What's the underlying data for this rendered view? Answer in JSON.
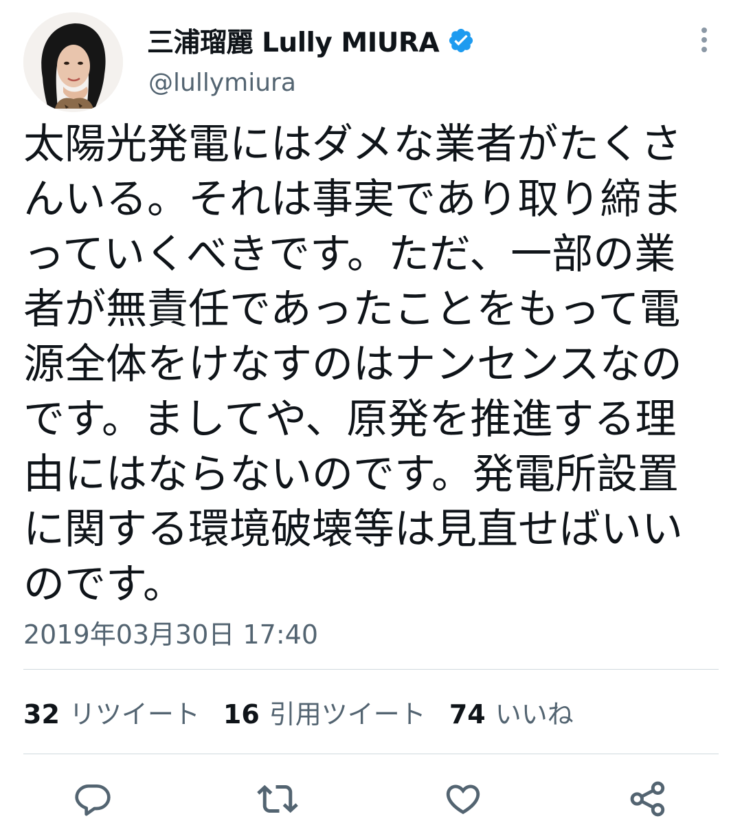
{
  "tweet": {
    "display_name": "三浦瑠麗 Lully MIURA",
    "handle": "@lullymiura",
    "verified": true,
    "text": "太陽光発電にはダメな業者がたくさんいる。それは事実であり取り締まっていくべきです。ただ、一部の業者が無責任であったことをもって電源全体をけなすのはナンセンスなのです。ましてや、原発を推進する理由にはならないのです。発電所設置に関する環境破壊等は見直せばいいのです。",
    "timestamp": "2019年03月30日 17:40"
  },
  "stats": [
    {
      "count": "32",
      "label": "リツイート"
    },
    {
      "count": "16",
      "label": "引用ツイート"
    },
    {
      "count": "74",
      "label": "いいね"
    }
  ],
  "actions": [
    {
      "icon": "reply-icon"
    },
    {
      "icon": "retweet-icon"
    },
    {
      "icon": "like-icon"
    },
    {
      "icon": "share-icon"
    }
  ],
  "colors": {
    "text": "#0f1419",
    "secondary": "#536471",
    "verified": "#1d9bf0",
    "divider": "#cfd9de"
  }
}
